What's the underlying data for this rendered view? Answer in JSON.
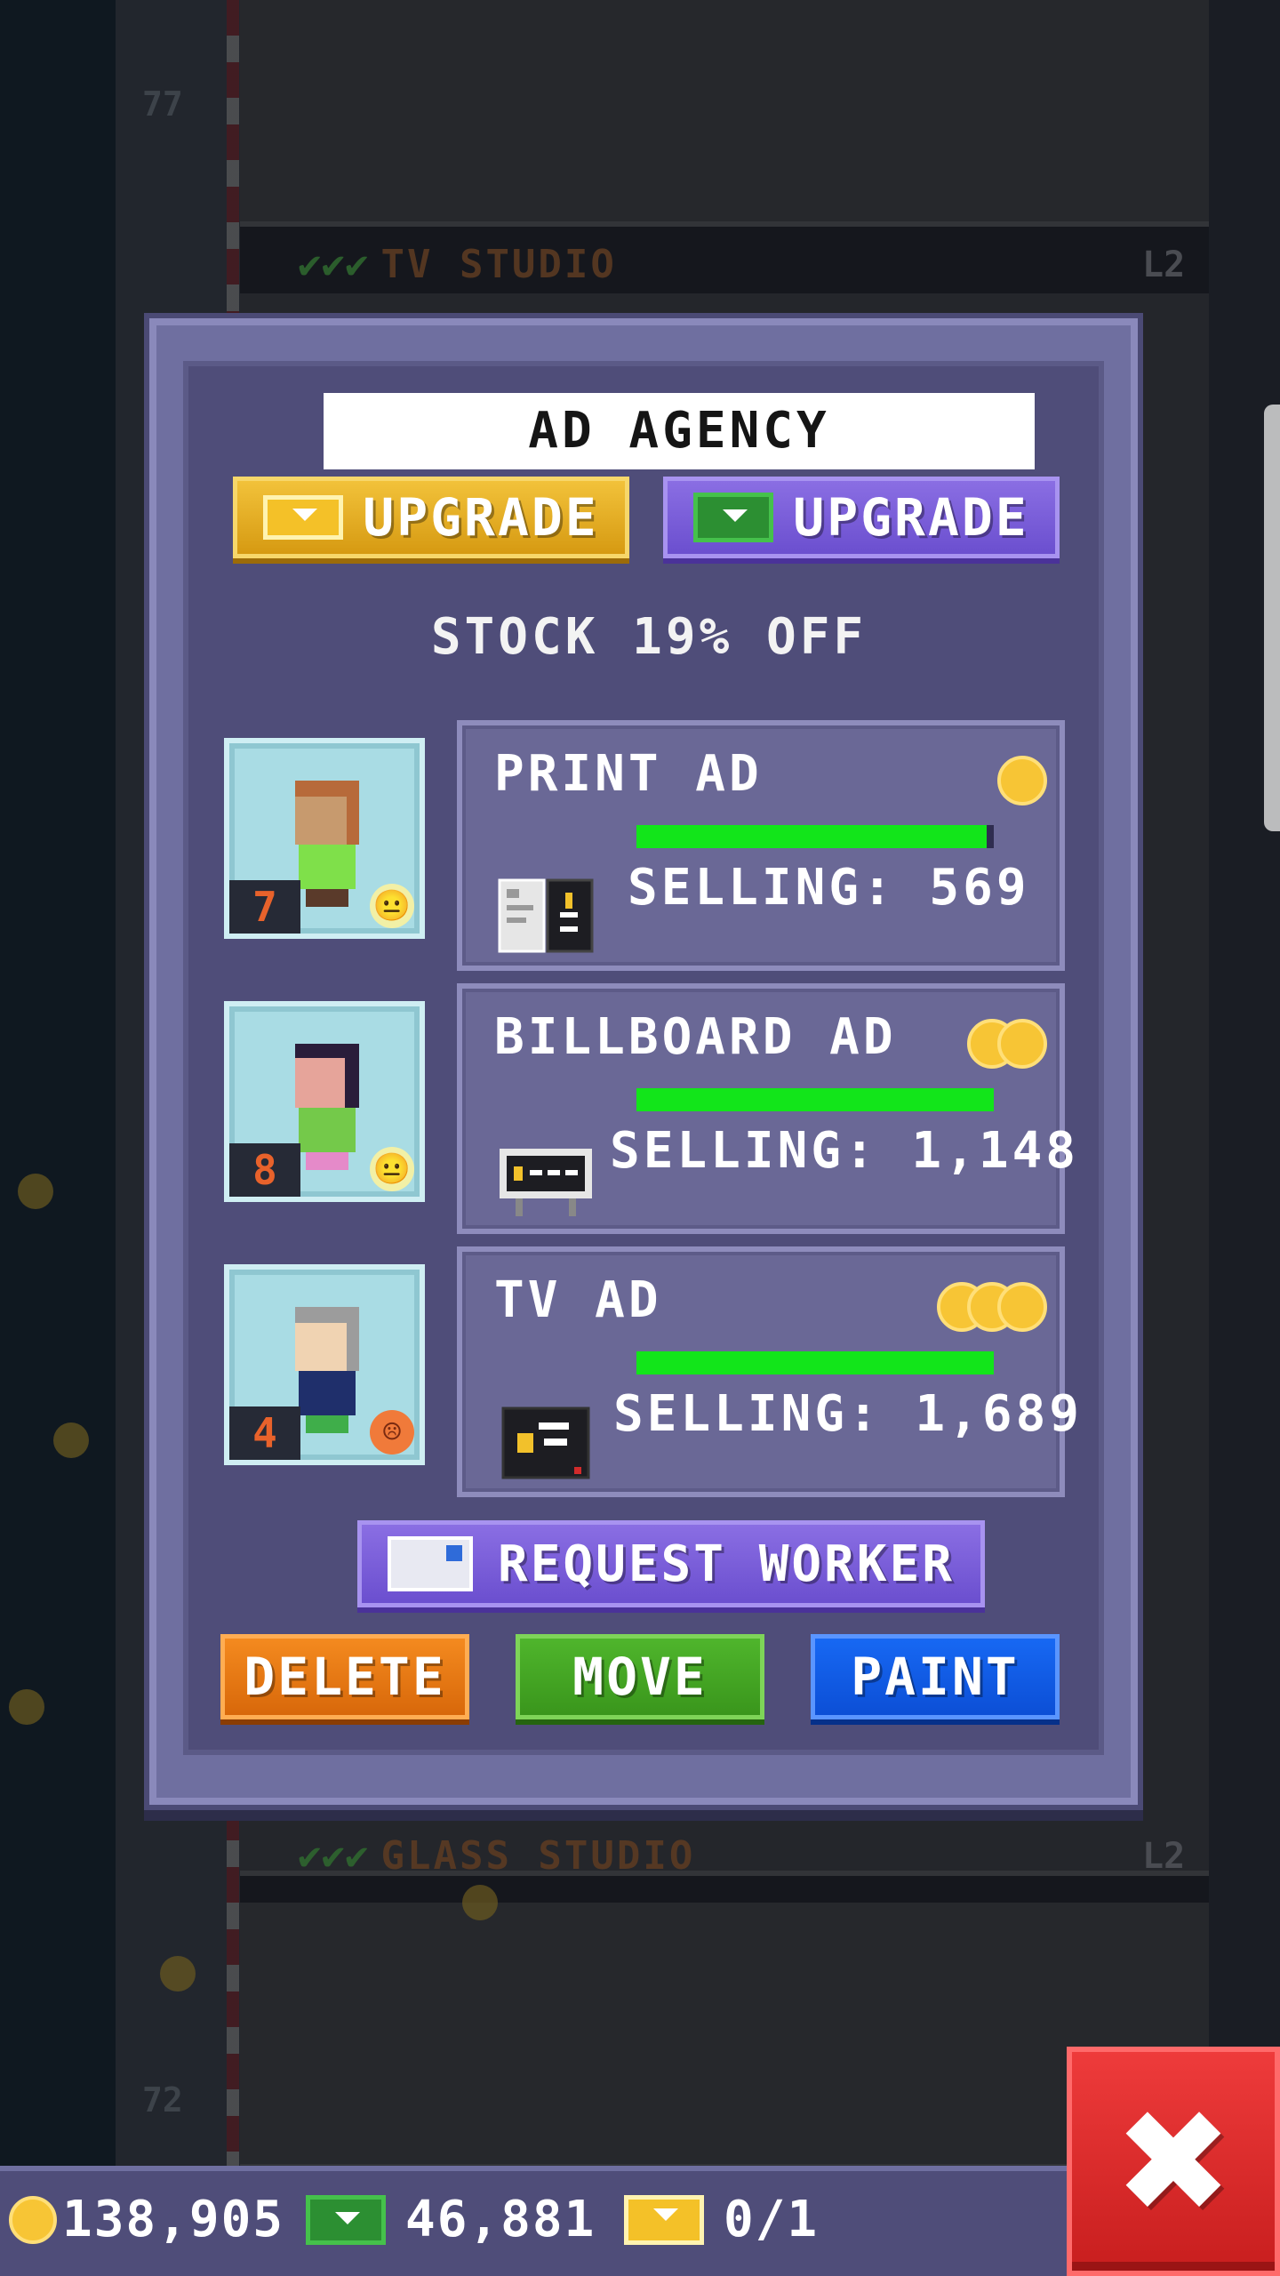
{
  "background": {
    "top_floor": {
      "name": "TV STUDIO",
      "level": "L2",
      "number": "77",
      "checks": "✔✔✔"
    },
    "bottom_floor": {
      "name": "GLASS STUDIO",
      "level": "L2",
      "number": "72",
      "checks": "✔✔✔"
    }
  },
  "dialog": {
    "title": "AD AGENCY",
    "upgrade_gold_label": "UPGRADE",
    "upgrade_cash_label": "UPGRADE",
    "discount_text": "STOCK 19% OFF",
    "workers": [
      {
        "count": "7",
        "mood": "neutral",
        "mood_glyph": "😐",
        "hair": "#b76a3a",
        "skin": "#c79a6e",
        "shirt": "#7fe04a"
      },
      {
        "count": "8",
        "mood": "neutral",
        "mood_glyph": "😐",
        "hair": "#2a1d3a",
        "skin": "#e6a49a",
        "shirt": "#74c94a"
      },
      {
        "count": "4",
        "mood": "sad",
        "mood_glyph": "☹",
        "hair": "#9c9c9c",
        "skin": "#f0d3b2",
        "shirt": "#1f2f6b"
      }
    ],
    "products": [
      {
        "name": "PRINT AD",
        "tier": 1,
        "progress": 0.98,
        "selling": "SELLING: 569",
        "icon": "print-ad-icon"
      },
      {
        "name": "BILLBOARD AD",
        "tier": 2,
        "progress": 1.0,
        "selling": "SELLING: 1,148",
        "icon": "billboard-ad-icon"
      },
      {
        "name": "TV AD",
        "tier": 3,
        "progress": 1.0,
        "selling": "SELLING: 1,689",
        "icon": "tv-ad-icon"
      }
    ],
    "request_worker_label": "REQUEST WORKER",
    "delete_label": "DELETE",
    "move_label": "MOVE",
    "paint_label": "PAINT"
  },
  "status": {
    "coins": "138,905",
    "bux": "46,881",
    "tickets": "0/1"
  },
  "colors": {
    "progress": "#12e51a",
    "coin": "#f7c535",
    "close": "#e02828"
  }
}
